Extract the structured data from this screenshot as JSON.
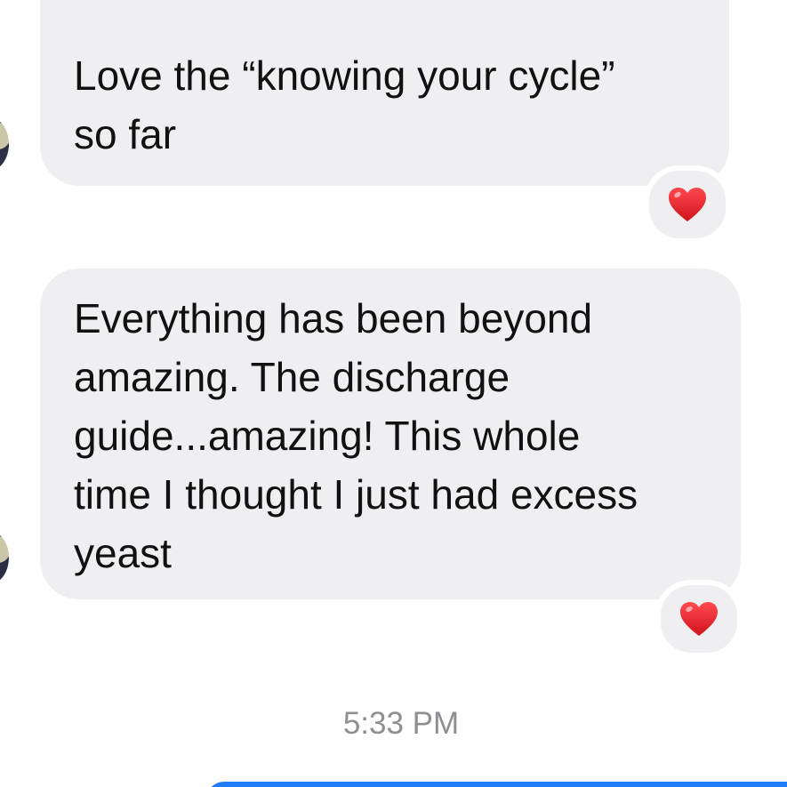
{
  "thread": {
    "messages": [
      {
        "direction": "incoming",
        "lines": [
          "Love the “knowing your cycle”",
          "so far"
        ],
        "reaction": "heart"
      },
      {
        "direction": "incoming",
        "lines": [
          "Everything has been beyond",
          "amazing. The discharge",
          "guide...amazing! This whole",
          "time I thought I just had excess",
          "yeast"
        ],
        "reaction": "heart"
      }
    ],
    "timestamp": "5:33 PM"
  },
  "colors": {
    "incoming_bubble": "#efeff1",
    "outgoing_bubble": "#1f7bf6",
    "heart": "#e0202b",
    "timestamp": "#8e8e93"
  }
}
